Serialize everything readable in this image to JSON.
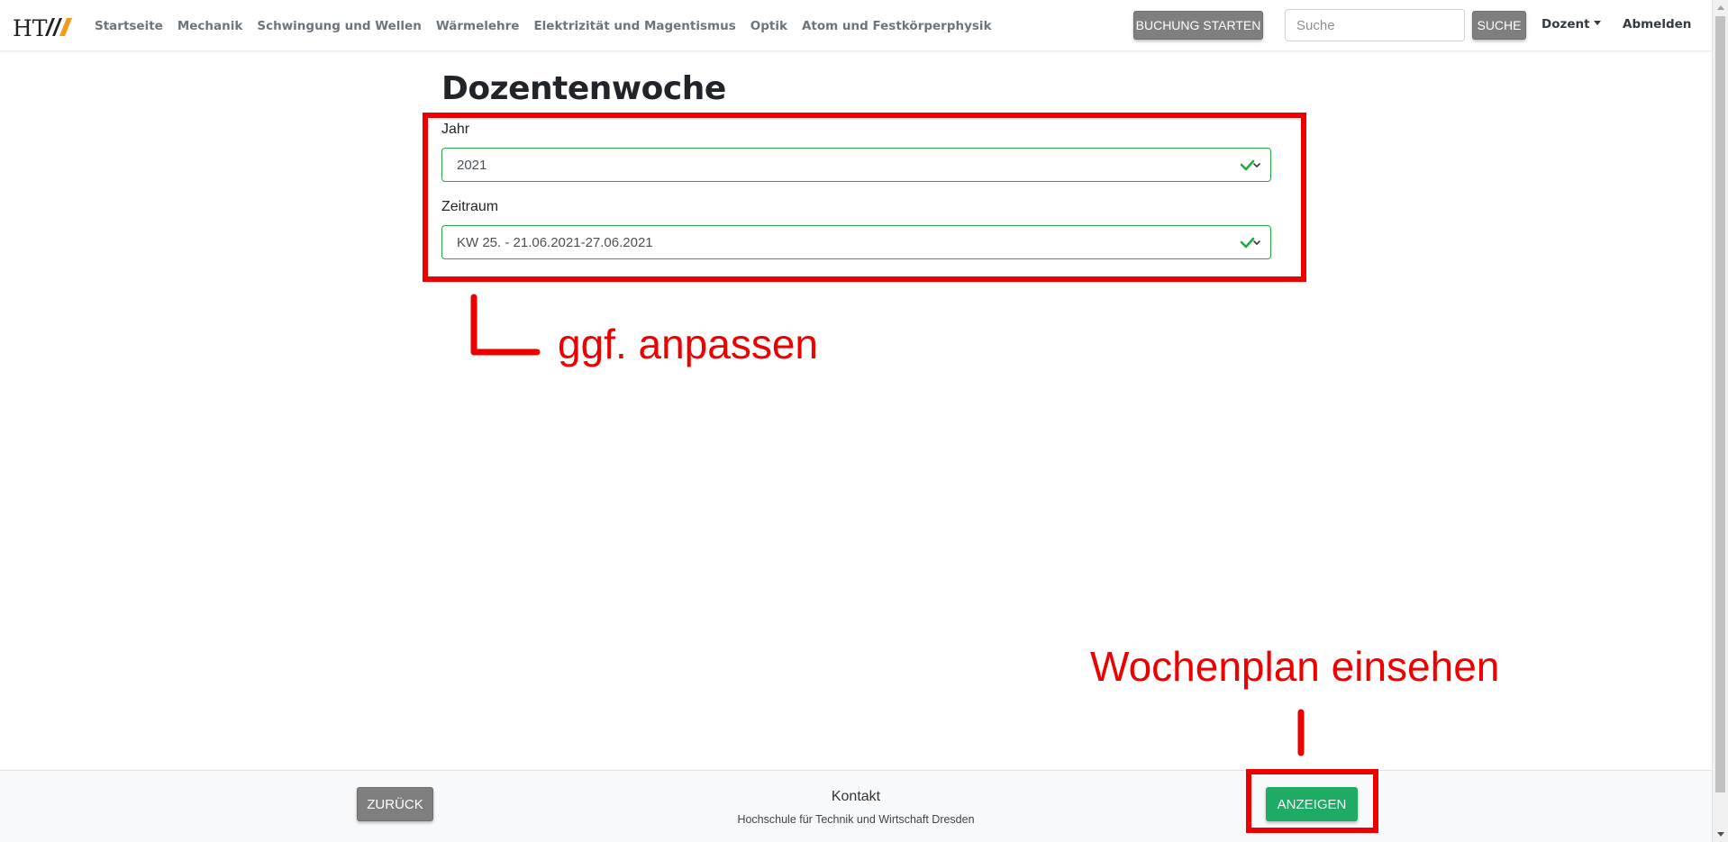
{
  "header": {
    "logo_text": "HTW",
    "nav_links": [
      "Startseite",
      "Mechanik",
      "Schwingung und Wellen",
      "Wärmelehre",
      "Elektrizität und Magentismus",
      "Optik",
      "Atom und Festkörperphysik"
    ],
    "booking_button": "BUCHUNG STARTEN",
    "search_placeholder": "Suche",
    "search_button": "SUCHE",
    "user_menu": "Dozent",
    "logout": "Abmelden"
  },
  "main": {
    "title": "Dozentenwoche",
    "year_label": "Jahr",
    "year_value": "2021",
    "period_label": "Zeitraum",
    "period_value": "KW 25. - 21.06.2021-27.06.2021"
  },
  "annotations": {
    "adjust_note": "ggf. anpassen",
    "view_note": "Wochenplan einsehen",
    "color": "#ee0000"
  },
  "footer": {
    "back_button": "ZURÜCK",
    "contact": "Kontakt",
    "address": "Hochschule für Technik und Wirtschaft Dresden",
    "show_button": "ANZEIGEN"
  },
  "colors": {
    "valid_border": "#28a745",
    "primary_action": "#1eab64",
    "secondary_button": "#7f7f7f"
  }
}
